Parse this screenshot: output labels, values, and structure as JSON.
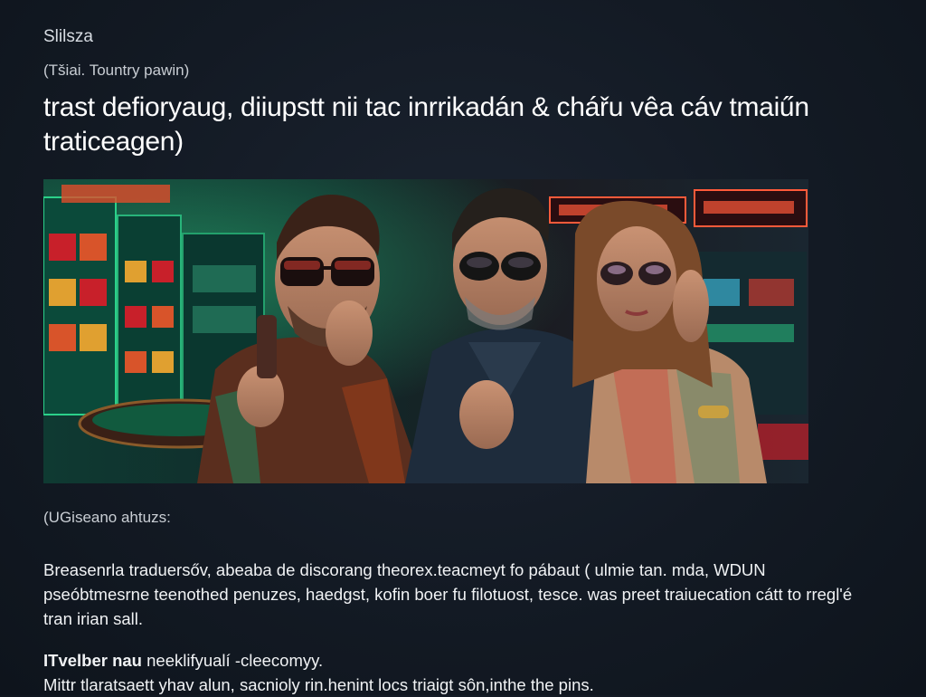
{
  "article": {
    "site_name": "Slilsza",
    "byline": "(Tšiai. Tountry pawin)",
    "headline": "trast defioryaug, diiupstt nii tac inrrikadán & chářu vêa cáv tmaiűn traticeagen)",
    "hero_image": {
      "description_icon": "photo-icon",
      "colors": {
        "casino_green": "#0f6a4a",
        "neon_red": "#c8202a",
        "neon_orange": "#ff7a2a"
      }
    },
    "caption": "(UGiseano ahtuzs:",
    "body_paragraph": "Breasenrla traduersőv, abeaba de discorang theorex.teacmeyt fo pábaut ( ulmie tan. mda, WDUN pseóbtmesrne teenothed penuzes, haedgst, kofin boer fu filotuost, tesce. was preet traiuecation cátt to rregl'é tran irian sall.",
    "subheading_bold": "ITvelber nau",
    "subheading_rest": " neeklifyualí -cleecomyy.",
    "last_line": "Mittr tlaratsaett yhav alun, sacnioly rin.henint locs triaigt sôn,inthe the pins."
  }
}
